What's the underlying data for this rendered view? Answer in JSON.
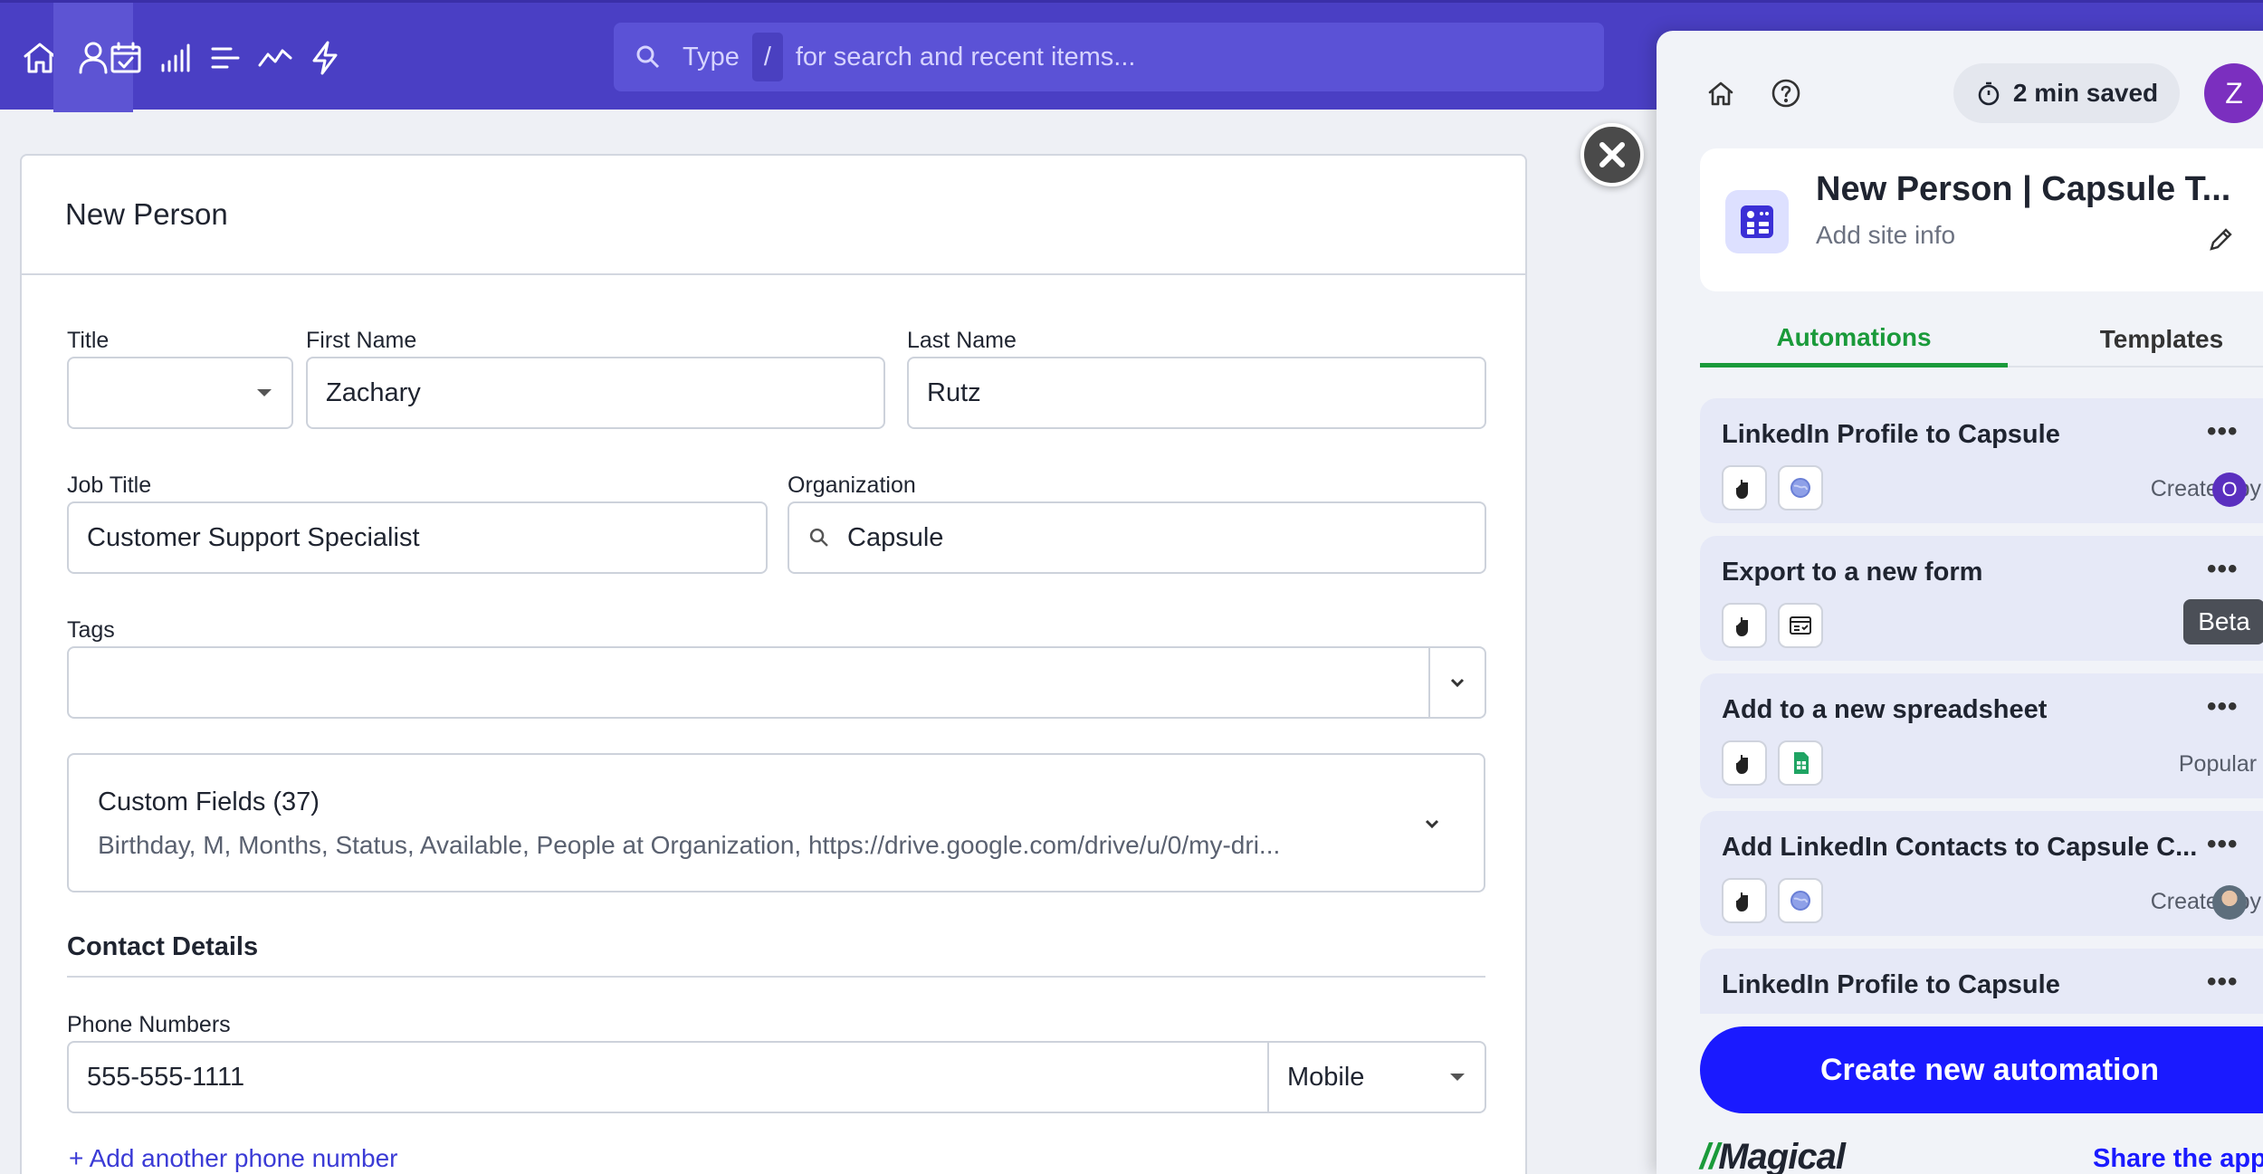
{
  "search": {
    "prefix": "Type",
    "key": "/",
    "suffix": "for search and recent items..."
  },
  "form": {
    "title": "New Person",
    "labels": {
      "title": "Title",
      "first_name": "First Name",
      "last_name": "Last Name",
      "job_title": "Job Title",
      "organization": "Organization",
      "tags": "Tags",
      "phone_numbers": "Phone Numbers"
    },
    "values": {
      "title": "",
      "first_name": "Zachary",
      "last_name": "Rutz",
      "job_title": "Customer Support Specialist",
      "organization": "Capsule",
      "phone": "555-555-1111",
      "phone_type": "Mobile"
    },
    "custom_fields": {
      "title": "Custom Fields (37)",
      "summary": "Birthday, M, Months, Status, Available, People at Organization, https://drive.google.com/drive/u/0/my-dri..."
    },
    "contact_details": "Contact Details",
    "add_phone": "+ Add another phone number"
  },
  "panel": {
    "saved": "2 min saved",
    "avatar": "Z",
    "site_title": "New Person | Capsule T...",
    "site_sub": "Add site info",
    "tabs": [
      "Automations",
      "Templates"
    ],
    "automations": [
      {
        "title": "LinkedIn Profile to Capsule",
        "meta": "Created by",
        "badge": "O"
      },
      {
        "title": "Export to a new form",
        "meta": "",
        "badge": "Beta"
      },
      {
        "title": "Add to a new spreadsheet",
        "meta": "Popular"
      },
      {
        "title": "Add LinkedIn Contacts to Capsule C...",
        "meta": "Created by"
      },
      {
        "title": "LinkedIn Profile to Capsule",
        "meta": ""
      }
    ],
    "create_button": "Create new automation",
    "brand": "Magical",
    "share": "Share the app"
  },
  "colors": {
    "topbar": "#4a3fc4",
    "accent_green": "#1a9a3a",
    "cta_blue": "#1a1aff"
  }
}
